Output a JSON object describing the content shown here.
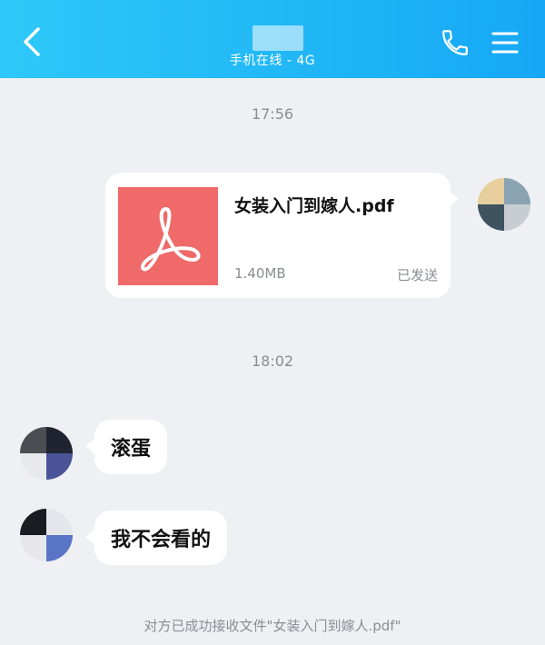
{
  "header": {
    "contact_name": "",
    "status": "手机在线 - 4G",
    "icons": {
      "back": "chevron-left-icon",
      "call": "phone-icon",
      "menu": "menu-icon"
    },
    "colors": {
      "bar_start": "#2ec8f8",
      "bar_end": "#16a8f5"
    }
  },
  "messages": {
    "time_1": "17:56",
    "file": {
      "name": "女装入门到嫁人.pdf",
      "size": "1.40MB",
      "status": "已发送",
      "icon": "pdf-icon",
      "thumb_color": "#f06a6a"
    },
    "time_2": "18:02",
    "text_1": "滚蛋",
    "text_2": "我不会看的"
  },
  "footer": {
    "notice": "对方已成功接收文件\"女装入门到嫁人.pdf\""
  }
}
